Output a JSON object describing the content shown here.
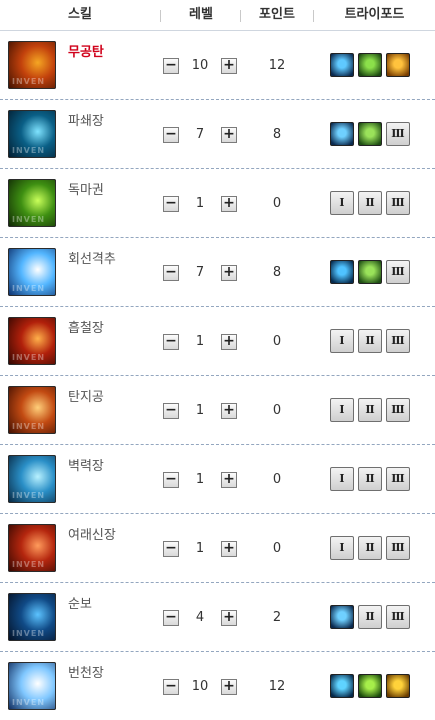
{
  "header": {
    "skill": "스킬",
    "level": "레벨",
    "point": "포인트",
    "tripod": "트라이포드"
  },
  "controls": {
    "minus_symbol": "−",
    "plus_symbol": "+"
  },
  "icon_watermark": "INVEN",
  "skills": [
    {
      "name": "무공탄",
      "level": "10",
      "points": "12",
      "highlight": true,
      "icon": "orange-fireball-icon",
      "icon_colors": [
        "#f5a623",
        "#c2410c",
        "#3a0f00"
      ],
      "tripods": [
        {
          "type": "icon",
          "icon": "blue-dash-strike-icon",
          "colors": [
            "#5fc9ff",
            "#0b2a4f"
          ]
        },
        {
          "type": "icon",
          "icon": "green-arrows-up-icon",
          "colors": [
            "#8be04a",
            "#1d4a12"
          ]
        },
        {
          "type": "icon",
          "icon": "orange-down-arrow-icon",
          "colors": [
            "#ffc23d",
            "#7a3e00"
          ]
        }
      ]
    },
    {
      "name": "파쇄장",
      "level": "7",
      "points": "8",
      "highlight": false,
      "icon": "blue-swirl-palm-icon",
      "icon_colors": [
        "#7fe3ff",
        "#0a5f86",
        "#031a2c"
      ],
      "tripods": [
        {
          "type": "icon",
          "icon": "blue-runner-icon",
          "colors": [
            "#6fd0ff",
            "#0b2a4f"
          ]
        },
        {
          "type": "icon",
          "icon": "green-group-icon",
          "colors": [
            "#9ae25a",
            "#1f4f14"
          ]
        },
        {
          "type": "roman",
          "label": "Ⅲ"
        }
      ]
    },
    {
      "name": "독마권",
      "level": "1",
      "points": "0",
      "highlight": false,
      "icon": "green-burst-fist-icon",
      "icon_colors": [
        "#c9ff5a",
        "#3e8f12",
        "#0d2204"
      ],
      "tripods": [
        {
          "type": "roman",
          "label": "Ⅰ"
        },
        {
          "type": "roman",
          "label": "Ⅱ"
        },
        {
          "type": "roman",
          "label": "Ⅲ"
        }
      ]
    },
    {
      "name": "회선격추",
      "level": "7",
      "points": "8",
      "highlight": false,
      "icon": "blue-light-burst-icon",
      "icon_colors": [
        "#ffffff",
        "#53b6ff",
        "#0a2a66"
      ],
      "tripods": [
        {
          "type": "icon",
          "icon": "blue-orb-icon",
          "colors": [
            "#4fc3ff",
            "#062b4e"
          ]
        },
        {
          "type": "icon",
          "icon": "green-group-icon",
          "colors": [
            "#9ae25a",
            "#1f4f14"
          ]
        },
        {
          "type": "roman",
          "label": "Ⅲ"
        }
      ]
    },
    {
      "name": "흡철장",
      "level": "1",
      "points": "0",
      "highlight": false,
      "icon": "red-flame-palm-icon",
      "icon_colors": [
        "#ffb04a",
        "#b1200b",
        "#2a0500"
      ],
      "tripods": [
        {
          "type": "roman",
          "label": "Ⅰ"
        },
        {
          "type": "roman",
          "label": "Ⅱ"
        },
        {
          "type": "roman",
          "label": "Ⅲ"
        }
      ]
    },
    {
      "name": "탄지공",
      "level": "1",
      "points": "0",
      "highlight": false,
      "icon": "orange-streak-icon",
      "icon_colors": [
        "#ffcf7a",
        "#c24a12",
        "#3b0c00"
      ],
      "tripods": [
        {
          "type": "roman",
          "label": "Ⅰ"
        },
        {
          "type": "roman",
          "label": "Ⅱ"
        },
        {
          "type": "roman",
          "label": "Ⅲ"
        }
      ]
    },
    {
      "name": "벽력장",
      "level": "1",
      "points": "0",
      "highlight": false,
      "icon": "blue-wave-palm-icon",
      "icon_colors": [
        "#b8f1ff",
        "#2a8fc7",
        "#06223a"
      ],
      "tripods": [
        {
          "type": "roman",
          "label": "Ⅰ"
        },
        {
          "type": "roman",
          "label": "Ⅱ"
        },
        {
          "type": "roman",
          "label": "Ⅲ"
        }
      ]
    },
    {
      "name": "여래신장",
      "level": "1",
      "points": "0",
      "highlight": false,
      "icon": "red-giant-palm-icon",
      "icon_colors": [
        "#ff9b5c",
        "#b4260e",
        "#2d0600"
      ],
      "tripods": [
        {
          "type": "roman",
          "label": "Ⅰ"
        },
        {
          "type": "roman",
          "label": "Ⅱ"
        },
        {
          "type": "roman",
          "label": "Ⅲ"
        }
      ]
    },
    {
      "name": "순보",
      "level": "4",
      "points": "2",
      "highlight": false,
      "icon": "blue-dash-figure-icon",
      "icon_colors": [
        "#5cc3ff",
        "#104a86",
        "#030d1f"
      ],
      "tripods": [
        {
          "type": "icon",
          "icon": "blue-runner-icon",
          "colors": [
            "#6fd0ff",
            "#0b2a4f"
          ]
        },
        {
          "type": "roman",
          "label": "Ⅱ"
        },
        {
          "type": "roman",
          "label": "Ⅲ"
        }
      ]
    },
    {
      "name": "번천장",
      "level": "10",
      "points": "12",
      "highlight": false,
      "icon": "blue-white-flash-icon",
      "icon_colors": [
        "#ffffff",
        "#7fc7ff",
        "#0a2456"
      ],
      "tripods": [
        {
          "type": "icon",
          "icon": "blue-splash-icon",
          "colors": [
            "#5fd3ff",
            "#06294a"
          ]
        },
        {
          "type": "icon",
          "icon": "green-cross-icon",
          "colors": [
            "#a6ee4a",
            "#1b4a0c"
          ]
        },
        {
          "type": "icon",
          "icon": "yellow-swirl-icon",
          "colors": [
            "#ffd23a",
            "#6a3d00"
          ]
        }
      ]
    }
  ]
}
